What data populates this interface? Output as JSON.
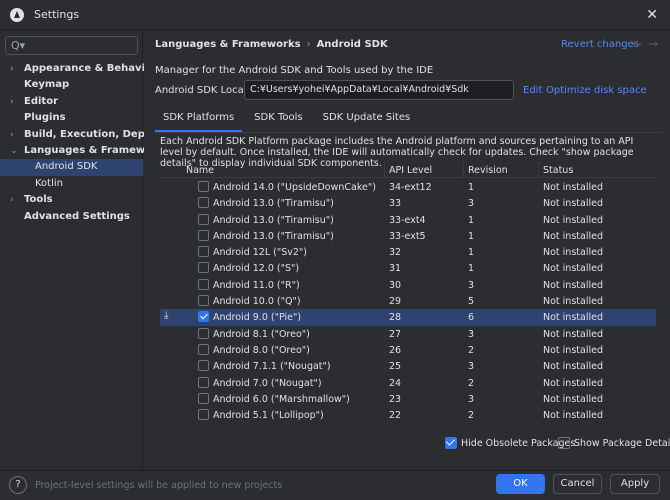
{
  "window": {
    "title": "Settings",
    "close_glyph": "✕"
  },
  "search": {
    "glyph": "Q▾"
  },
  "sidebar": {
    "items": [
      {
        "label": "Appearance & Behavior",
        "chevron": "›",
        "level": 0
      },
      {
        "label": "Keymap",
        "chevron": "",
        "level": 0
      },
      {
        "label": "Editor",
        "chevron": "›",
        "level": 0
      },
      {
        "label": "Plugins",
        "chevron": "",
        "level": 0
      },
      {
        "label": "Build, Execution, Deployment",
        "chevron": "›",
        "level": 0
      },
      {
        "label": "Languages & Frameworks",
        "chevron": "⌄",
        "level": 0
      },
      {
        "label": "Android SDK",
        "chevron": "",
        "level": 1,
        "selected": true
      },
      {
        "label": "Kotlin",
        "chevron": "",
        "level": 1
      },
      {
        "label": "Tools",
        "chevron": "›",
        "level": 0
      },
      {
        "label": "Advanced Settings",
        "chevron": "",
        "level": 0
      }
    ]
  },
  "header": {
    "crumb_parent": "Languages & Frameworks",
    "crumb_sep": "›",
    "crumb_current": "Android SDK",
    "revert": "Revert changes",
    "nav_back": "←",
    "nav_forward": "→"
  },
  "main": {
    "description": "Manager for the Android SDK and Tools used by the IDE",
    "location_label": "Android SDK Location:",
    "location_value": "C:¥Users¥yohei¥AppData¥Local¥Android¥Sdk",
    "edit_link": "Edit",
    "optimize_link": "Optimize disk space",
    "tabs": [
      "SDK Platforms",
      "SDK Tools",
      "SDK Update Sites"
    ],
    "info": "Each Android SDK Platform package includes the Android platform and sources pertaining to an API level by default. Once installed, the IDE will automatically check for updates. Check \"show package details\" to display individual SDK components."
  },
  "table": {
    "headers": {
      "name": "Name",
      "api": "API Level",
      "revision": "Revision",
      "status": "Status"
    },
    "rows": [
      {
        "name": "Android 14.0 (\"UpsideDownCake\")",
        "api": "34-ext12",
        "revision": "1",
        "status": "Not installed",
        "checked": false
      },
      {
        "name": "Android 13.0 (\"Tiramisu\")",
        "api": "33",
        "revision": "3",
        "status": "Not installed",
        "checked": false
      },
      {
        "name": "Android 13.0 (\"Tiramisu\")",
        "api": "33-ext4",
        "revision": "1",
        "status": "Not installed",
        "checked": false
      },
      {
        "name": "Android 13.0 (\"Tiramisu\")",
        "api": "33-ext5",
        "revision": "1",
        "status": "Not installed",
        "checked": false
      },
      {
        "name": "Android 12L (\"Sv2\")",
        "api": "32",
        "revision": "1",
        "status": "Not installed",
        "checked": false
      },
      {
        "name": "Android 12.0 (\"S\")",
        "api": "31",
        "revision": "1",
        "status": "Not installed",
        "checked": false
      },
      {
        "name": "Android 11.0 (\"R\")",
        "api": "30",
        "revision": "3",
        "status": "Not installed",
        "checked": false
      },
      {
        "name": "Android 10.0 (\"Q\")",
        "api": "29",
        "revision": "5",
        "status": "Not installed",
        "checked": false
      },
      {
        "name": "Android 9.0 (\"Pie\")",
        "api": "28",
        "revision": "6",
        "status": "Not installed",
        "checked": true,
        "selected": true,
        "download_glyph": "⤓"
      },
      {
        "name": "Android 8.1 (\"Oreo\")",
        "api": "27",
        "revision": "3",
        "status": "Not installed",
        "checked": false
      },
      {
        "name": "Android 8.0 (\"Oreo\")",
        "api": "26",
        "revision": "2",
        "status": "Not installed",
        "checked": false
      },
      {
        "name": "Android 7.1.1 (\"Nougat\")",
        "api": "25",
        "revision": "3",
        "status": "Not installed",
        "checked": false
      },
      {
        "name": "Android 7.0 (\"Nougat\")",
        "api": "24",
        "revision": "2",
        "status": "Not installed",
        "checked": false
      },
      {
        "name": "Android 6.0 (\"Marshmallow\")",
        "api": "23",
        "revision": "3",
        "status": "Not installed",
        "checked": false
      },
      {
        "name": "Android 5.1 (\"Lollipop\")",
        "api": "22",
        "revision": "2",
        "status": "Not installed",
        "checked": false
      }
    ]
  },
  "options": {
    "hide_obsolete": {
      "label": "Hide Obsolete Packages",
      "checked": true
    },
    "show_details": {
      "label": "Show Package Details",
      "checked": false
    }
  },
  "footer": {
    "help": "?",
    "note": "Project-level settings will be applied to new projects",
    "ok": "OK",
    "cancel": "Cancel",
    "apply": "Apply"
  },
  "colors": {
    "accent": "#3574f0",
    "link": "#548af7",
    "selection": "#2e436e",
    "background": "#2b2d30"
  }
}
